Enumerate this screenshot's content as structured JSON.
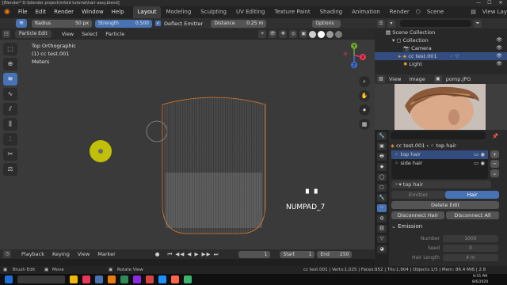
{
  "titlebar": {
    "text": "[Blender* D:\\blender project\\mfold tutorial\\hair easy.blend]",
    "minimize": "—",
    "maximize": "☐",
    "close": "✕"
  },
  "menu": {
    "items": [
      "File",
      "Edit",
      "Render",
      "Window",
      "Help"
    ]
  },
  "workspaces": {
    "tabs": [
      "Layout",
      "Modeling",
      "Sculpting",
      "UV Editing",
      "Texture Paint",
      "Shading",
      "Animation",
      "Render"
    ],
    "active": "Layout"
  },
  "scene": {
    "label": "Scene",
    "view_layer": "View Layer"
  },
  "toolheader": {
    "mode_label": "Particle Edit",
    "radius_label": "Radius",
    "radius_value": "50 px",
    "strength_label": "Strength",
    "strength_value": "0.500",
    "deflect_label": "Deflect Emitter",
    "deflect_check": "✓",
    "distance_label": "Distance",
    "distance_value": "0.25 m",
    "options_label": "Options"
  },
  "viewport": {
    "menus": [
      "View",
      "Select",
      "Particle"
    ],
    "info_line1": "Top Orthographic",
    "info_line2": "(1) cc test.001",
    "info_line3": "Meters",
    "numpad_hint": "NUMPAD_7",
    "key_glyph": "▘▝",
    "gizmo_x": "X",
    "gizmo_y": "Y",
    "gizmo_z": "Z"
  },
  "timeline": {
    "menus": [
      "Playback",
      "Keying",
      "View",
      "Marker"
    ],
    "current_frame": "1",
    "start_label": "Start",
    "start_value": "1",
    "end_label": "End",
    "end_value": "250"
  },
  "statusbar": {
    "left1": "Brush Edit",
    "left2": "Move",
    "left3": "Rotate View",
    "stats": "cc test.001 | Verts:1,025 | Faces:952 | Tris:1,904 | Objects:1/3 | Mem: 86.4 MiB | 2.8"
  },
  "outliner": {
    "rows": [
      {
        "name": "Scene Collection"
      },
      {
        "name": "Collection"
      },
      {
        "name": "Camera"
      },
      {
        "name": "cc test.001"
      },
      {
        "name": "Light"
      }
    ]
  },
  "image_editor": {
    "menus": [
      "View",
      "Image"
    ],
    "image_name": "pomp.JPG"
  },
  "properties": {
    "breadcrumb_object": "cc test.001",
    "breadcrumb_system": "top hair",
    "particle_systems": [
      "top hair",
      "side hair"
    ],
    "settings_name": "top hair",
    "type_options": [
      "Emitter",
      "Hair"
    ],
    "type_selected": "Hair",
    "delete_edit": "Delete Edit",
    "disconnect_hair": "Disconnect Hair",
    "disconnect_all": "Disconnect All",
    "emission_label": "Emission",
    "number_label": "Number",
    "number_value": "1000",
    "seed_label": "Seed",
    "seed_value": "0",
    "hair_length_label": "Hair Length",
    "hair_length_value": "4 m"
  },
  "taskbar": {
    "time": "9:55 PM",
    "date": "8/6/2020"
  },
  "colors": {
    "accent": "#4772b3",
    "selection": "#334d80",
    "brush_cursor": "#d8d800",
    "bg": "#3a3a3a"
  }
}
